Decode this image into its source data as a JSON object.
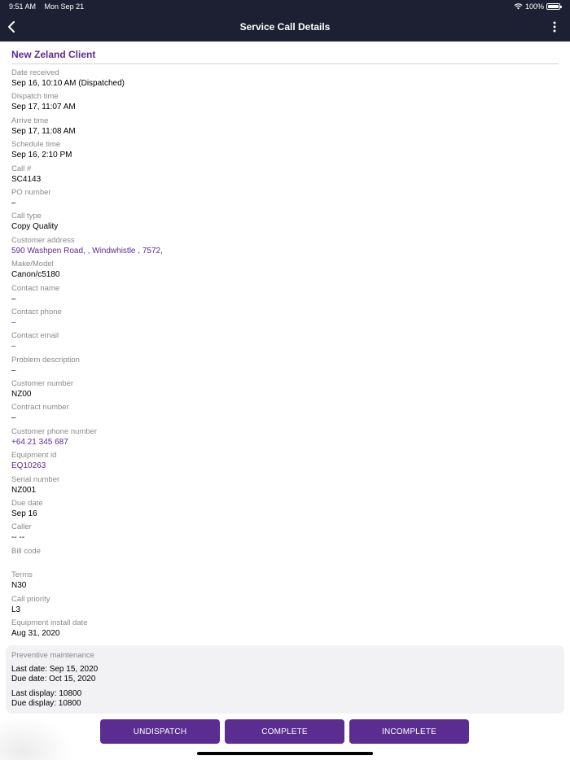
{
  "status_bar": {
    "time": "9:51 AM",
    "date": "Mon Sep 21",
    "battery": "100%"
  },
  "header": {
    "title": "Service Call Details",
    "back_icon": "chevron-left-icon",
    "more_icon": "more-vertical-icon",
    "background": "#1c2032"
  },
  "client": {
    "name": "New Zeland Client"
  },
  "accent_color": "#5b2d90",
  "fields": [
    {
      "label": "Date received",
      "value": "Sep 16, 10:10 AM (Dispatched)",
      "link": false
    },
    {
      "label": "Dispatch time",
      "value": "Sep 17, 11:07 AM",
      "link": false
    },
    {
      "label": "Arrive time",
      "value": "Sep 17, 11:08 AM",
      "link": false
    },
    {
      "label": "Schedule time",
      "value": "Sep 16, 2:10 PM",
      "link": false
    },
    {
      "label": "Call #",
      "value": "SC4143",
      "link": false
    },
    {
      "label": "PO number",
      "value": "–",
      "link": false
    },
    {
      "label": "Call type",
      "value": "Copy Quality",
      "link": false
    },
    {
      "label": "Customer address",
      "value": "590 Washpen Road, , Windwhistle , 7572,",
      "link": true
    },
    {
      "label": "Make/Model",
      "value": "Canon/c5180",
      "link": false
    },
    {
      "label": "Contact name",
      "value": "–",
      "link": false
    },
    {
      "label": "Contact phone",
      "value": "–",
      "link": true
    },
    {
      "label": "Contact email",
      "value": "–",
      "link": true
    },
    {
      "label": "Problem description",
      "value": "–",
      "link": false
    },
    {
      "label": "Customer number",
      "value": "NZ00",
      "link": false
    },
    {
      "label": "Contract number",
      "value": "–",
      "link": false
    },
    {
      "label": "Customer phone number",
      "value": "+64 21 345 687",
      "link": true
    },
    {
      "label": "Equipment id",
      "value": "EQ10263",
      "link": true
    },
    {
      "label": "Serial number",
      "value": "NZ001",
      "link": false
    },
    {
      "label": "Due date",
      "value": "Sep 16",
      "link": false
    },
    {
      "label": "Caller",
      "value": "-- --",
      "link": false
    },
    {
      "label": "Bill code",
      "value": "",
      "link": false
    },
    {
      "label": "Terms",
      "value": "N30",
      "link": false
    },
    {
      "label": "Call priority",
      "value": "L3",
      "link": false
    },
    {
      "label": "Equipment install date",
      "value": "Aug 31, 2020",
      "link": false
    }
  ],
  "preventive_maintenance": {
    "title": "Preventive maintenance",
    "last_date": "Last date: Sep 15, 2020",
    "due_date": "Due date: Oct 15, 2020",
    "last_display": "Last display: 10800",
    "due_display": "Due display: 10800"
  },
  "actions": {
    "undispatch": "UNDISPATCH",
    "complete": "COMPLETE",
    "incomplete": "INCOMPLETE"
  }
}
